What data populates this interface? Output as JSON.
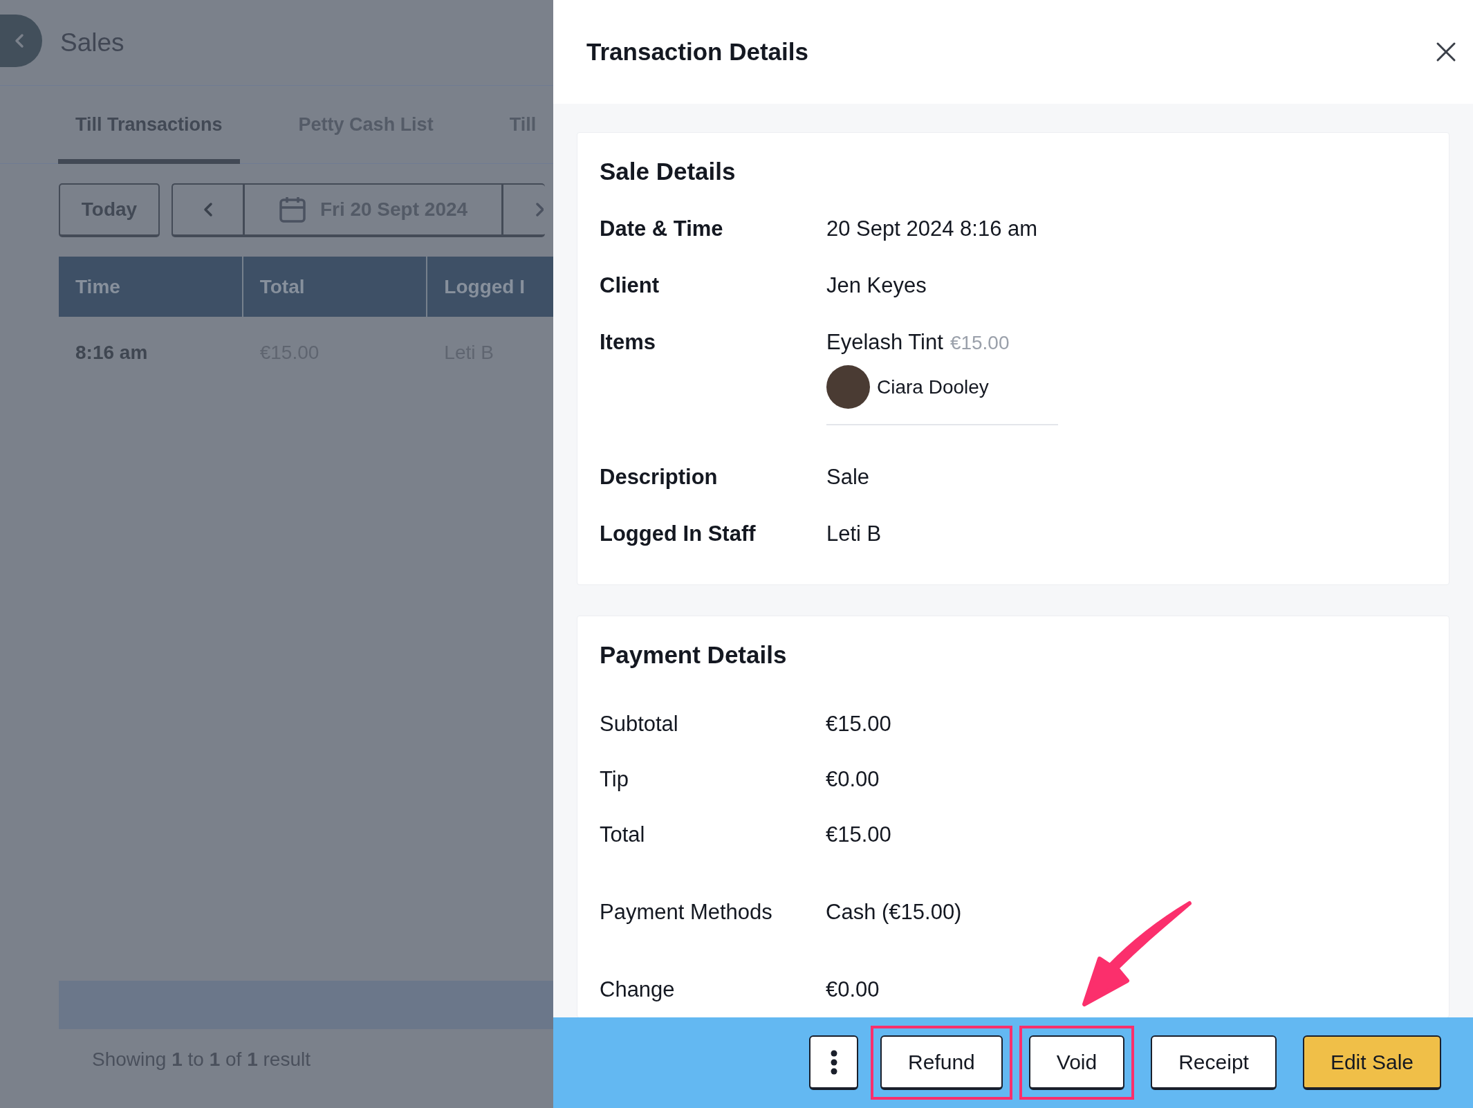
{
  "page": {
    "title": "Sales"
  },
  "tabs": [
    {
      "label": "Till Transactions",
      "selected": true
    },
    {
      "label": "Petty Cash List",
      "selected": false
    },
    {
      "label": "Till",
      "selected": false
    }
  ],
  "toolbar": {
    "today": "Today",
    "date": "Fri 20 Sept 2024"
  },
  "table": {
    "columns": [
      "Time",
      "Total",
      "Logged I"
    ],
    "rows": [
      [
        "8:16 am",
        "€15.00",
        "Leti B"
      ]
    ],
    "footer": "Showing **1** to **1** of **1** result"
  },
  "drawer": {
    "title": "Transaction Details",
    "sale_details": {
      "title": "Sale Details",
      "rows": [
        {
          "kind": "text",
          "label": "Date & Time",
          "value": "20 Sept 2024 8:16 am"
        },
        {
          "kind": "text",
          "label": "Client",
          "value": "Jen Keyes"
        },
        {
          "kind": "items",
          "label": "Items",
          "value": "Eyelash Tint",
          "price": "€15.00",
          "staff": "Ciara Dooley"
        },
        {
          "kind": "text",
          "label": "Description",
          "value": "Sale"
        },
        {
          "kind": "text",
          "label": "Logged In Staff",
          "value": "Leti B"
        }
      ]
    },
    "payment_details": {
      "title": "Payment Details",
      "rows": [
        {
          "label": "Subtotal",
          "value": "€15.00"
        },
        {
          "label": "Tip",
          "value": "€0.00"
        },
        {
          "label": "Total",
          "value": "€15.00"
        },
        {
          "label": "Payment Methods",
          "value": "Cash (€15.00)"
        },
        {
          "label": "Change",
          "value": "€0.00"
        }
      ]
    },
    "buttons": [
      {
        "label": "Refund",
        "highlighted": true,
        "primary": false
      },
      {
        "label": "Void",
        "highlighted": true,
        "primary": false
      },
      {
        "label": "Receipt",
        "highlighted": false,
        "primary": false
      },
      {
        "label": "Edit Sale",
        "highlighted": false,
        "primary": true
      }
    ]
  }
}
